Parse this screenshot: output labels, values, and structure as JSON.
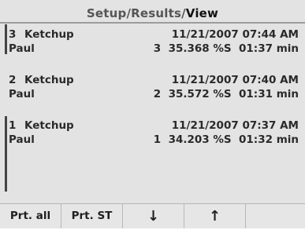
{
  "header": {
    "breadcrumb_1": "Setup",
    "sep_1": "/",
    "breadcrumb_2": "Results",
    "sep_2": "/",
    "breadcrumb_active": "View"
  },
  "results": [
    {
      "number": "3",
      "sample": "Ketchup",
      "datetime": "11/21/2007 07:44 AM",
      "user": "Paul",
      "result": "3  35.368 %S  01:37 min"
    },
    {
      "number": "2",
      "sample": "Ketchup",
      "datetime": "11/21/2007 07:40 AM",
      "user": "Paul",
      "result": "2  35.572 %S  01:31 min"
    },
    {
      "number": "1",
      "sample": "Ketchup",
      "datetime": "11/21/2007 07:37 AM",
      "user": "Paul",
      "result": "1  34.203 %S  01:32 min"
    }
  ],
  "softkeys": {
    "print_all": "Prt. all",
    "print_st": "Prt. ST",
    "down": "↓",
    "up": "↑",
    "empty": ""
  },
  "icons": {
    "down": "arrow-down-icon",
    "up": "arrow-up-icon"
  }
}
